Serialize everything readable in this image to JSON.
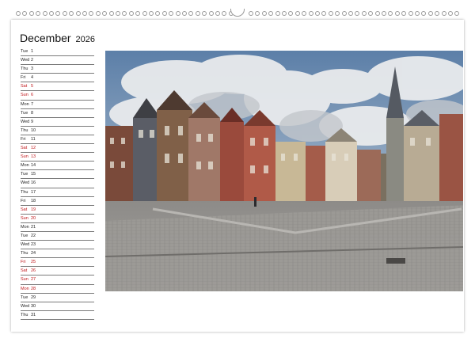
{
  "calendar": {
    "month": "December",
    "year": "2026",
    "days": [
      {
        "wd": "Tue",
        "num": "1",
        "weekend": false
      },
      {
        "wd": "Wed",
        "num": "2",
        "weekend": false
      },
      {
        "wd": "Thu",
        "num": "3",
        "weekend": false
      },
      {
        "wd": "Fri",
        "num": "4",
        "weekend": false
      },
      {
        "wd": "Sat",
        "num": "5",
        "weekend": true
      },
      {
        "wd": "Sun",
        "num": "6",
        "weekend": true
      },
      {
        "wd": "Mon",
        "num": "7",
        "weekend": false
      },
      {
        "wd": "Tue",
        "num": "8",
        "weekend": false
      },
      {
        "wd": "Wed",
        "num": "9",
        "weekend": false
      },
      {
        "wd": "Thu",
        "num": "10",
        "weekend": false
      },
      {
        "wd": "Fri",
        "num": "11",
        "weekend": false
      },
      {
        "wd": "Sat",
        "num": "12",
        "weekend": true
      },
      {
        "wd": "Sun",
        "num": "13",
        "weekend": true
      },
      {
        "wd": "Mon",
        "num": "14",
        "weekend": false
      },
      {
        "wd": "Tue",
        "num": "15",
        "weekend": false
      },
      {
        "wd": "Wed",
        "num": "16",
        "weekend": false
      },
      {
        "wd": "Thu",
        "num": "17",
        "weekend": false
      },
      {
        "wd": "Fri",
        "num": "18",
        "weekend": false
      },
      {
        "wd": "Sat",
        "num": "19",
        "weekend": true
      },
      {
        "wd": "Sun",
        "num": "20",
        "weekend": true
      },
      {
        "wd": "Mon",
        "num": "21",
        "weekend": false
      },
      {
        "wd": "Tue",
        "num": "22",
        "weekend": false
      },
      {
        "wd": "Wed",
        "num": "23",
        "weekend": false
      },
      {
        "wd": "Thu",
        "num": "24",
        "weekend": false
      },
      {
        "wd": "Fri",
        "num": "25",
        "weekend": true
      },
      {
        "wd": "Sat",
        "num": "26",
        "weekend": true
      },
      {
        "wd": "Sun",
        "num": "27",
        "weekend": true
      },
      {
        "wd": "Mon",
        "num": "28",
        "weekend": true
      },
      {
        "wd": "Tue",
        "num": "29",
        "weekend": false
      },
      {
        "wd": "Wed",
        "num": "30",
        "weekend": false
      },
      {
        "wd": "Thu",
        "num": "31",
        "weekend": false
      }
    ]
  },
  "colors": {
    "weekday_text": "#222222",
    "weekend_text": "#c0161a",
    "rule_line": "#7a7a7a"
  },
  "photo": {
    "icon": "town-square-photo"
  }
}
